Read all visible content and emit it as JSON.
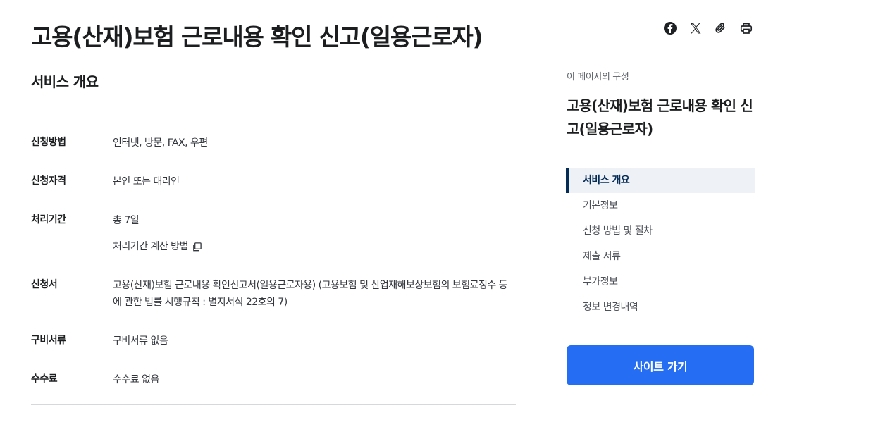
{
  "page": {
    "title": "고용(산재)보험 근로내용 확인 신고(일용근로자)"
  },
  "share": {
    "icons": [
      "facebook-icon",
      "x-icon",
      "clip-icon",
      "printer-icon"
    ]
  },
  "overview": {
    "title": "서비스 개요",
    "rows": [
      {
        "label": "신청방법",
        "value": "인터넷, 방문, FAX, 우편"
      },
      {
        "label": "신청자격",
        "value": "본인 또는 대리인"
      },
      {
        "label": "처리기간",
        "value": "총 7일",
        "sub": "처리기간 계산 방법"
      },
      {
        "label": "신청서",
        "value": "고용(산재)보험 근로내용 확인신고서(일용근로자용) (고용보험 및 산업재해보상보험의 보험료징수 등에 관한 법률 시행규칙 : 별지서식 22호의 7)"
      },
      {
        "label": "구비서류",
        "value": "구비서류 없음"
      },
      {
        "label": "수수료",
        "value": "수수료 없음"
      }
    ]
  },
  "toc": {
    "caption": "이 페이지의 구성",
    "title": "고용(산재)보험 근로내용 확인 신고(일용근로자)",
    "items": [
      "서비스 개요",
      "기본정보",
      "신청 방법 및 절차",
      "제출 서류",
      "부가정보",
      "정보 변경내역"
    ],
    "active_index": 0
  },
  "site_button": {
    "label": "사이트 가기"
  },
  "colors": {
    "primary": "#256ef4",
    "nav_active": "#052b57",
    "nav_active_bg": "#eef1f5"
  }
}
